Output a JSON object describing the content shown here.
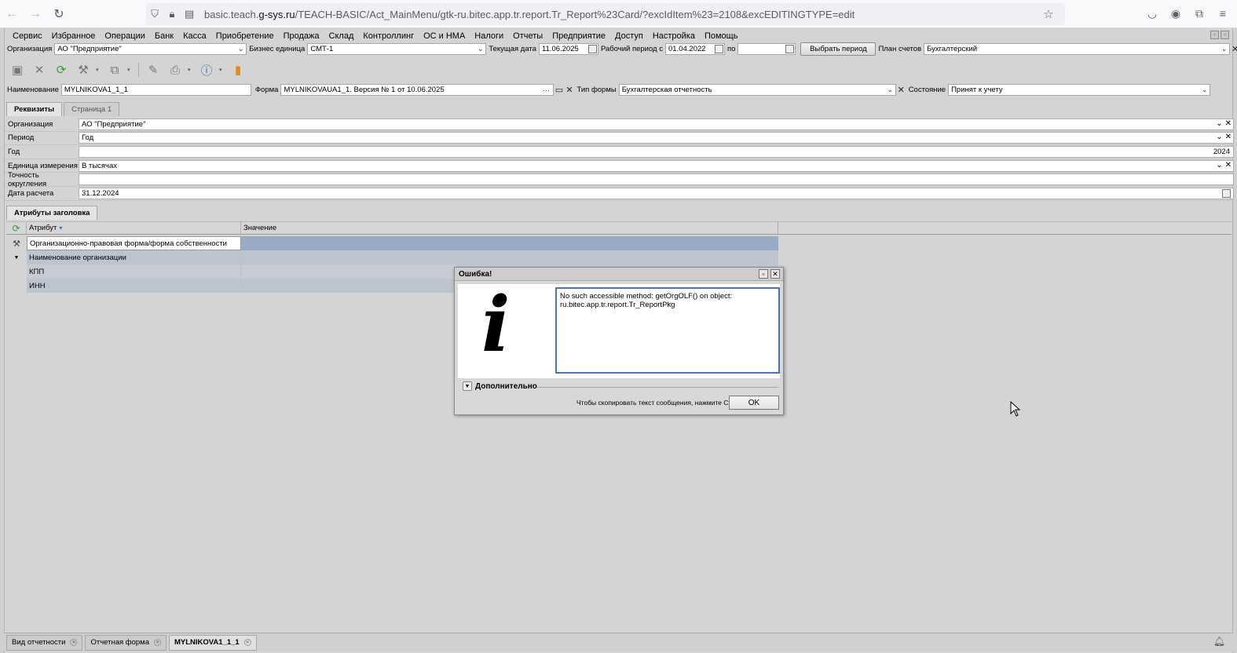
{
  "browser": {
    "url_prefix": "basic.teach.",
    "url_host": "g-sys.ru",
    "url_path": "/TEACH-BASIC/Act_MainMenu/gtk-ru.bitec.app.tr.report.Tr_Report%23Card/?excIdItem%23=2108&excEDITINGTYPE=edit"
  },
  "menu": [
    "Сервис",
    "Избранное",
    "Операции",
    "Банк",
    "Касса",
    "Приобретение",
    "Продажа",
    "Склад",
    "Контроллинг",
    "ОС и НМА",
    "Налоги",
    "Отчеты",
    "Предприятие",
    "Доступ",
    "Настройка",
    "Помощь"
  ],
  "filters": {
    "org_label": "Организация",
    "org_value": "АО \"Предприятие\"",
    "bu_label": "Бизнес единица",
    "bu_value": "СМТ-1",
    "date_label": "Текущая дата",
    "date_value": "11.06.2025",
    "period_label": "Рабочий период с",
    "period_from": "01.04.2022",
    "period_to_label": "по",
    "period_to": "",
    "choose_period": "Выбрать период",
    "chart_label": "План счетов",
    "chart_value": "Бухгалтерский"
  },
  "header": {
    "name_label": "Наименование",
    "name_value": "MYLNIKOVA1_1_1",
    "form_label": "Форма",
    "form_value": "MYLNIKOVAUA1_1. Версия № 1 от 10.06.2025",
    "form_dots": "···",
    "type_label": "Тип формы",
    "type_value": "Бухгалтерская отчетность",
    "state_label": "Состояние",
    "state_value": "Принят к учету"
  },
  "tabs": [
    "Реквизиты",
    "Страница 1"
  ],
  "props": [
    {
      "label": "Организация",
      "value": "АО \"Предприятие\""
    },
    {
      "label": "Период",
      "value": "Год"
    },
    {
      "label": "Год",
      "value": "2024"
    },
    {
      "label": "Единица измерения",
      "value": "В тысячах"
    },
    {
      "label": "Точность округления",
      "value": ""
    },
    {
      "label": "Дата расчета",
      "value": "31.12.2024"
    }
  ],
  "attr_tab": "Атрибуты заголовка",
  "attr_table": {
    "col_attr": "Атрибут",
    "col_value": "Значение",
    "rows": [
      {
        "attr": "Организационно-правовая форма/форма собственности",
        "value": ""
      },
      {
        "attr": "Наименование организации",
        "value": ""
      },
      {
        "attr": "КПП",
        "value": ""
      },
      {
        "attr": "ИНН",
        "value": ""
      }
    ]
  },
  "dialog": {
    "title": "Ошибка!",
    "info_glyph": "i",
    "message": "No such accessible method: getOrgOLF() on object:\nru.bitec.app.tr.report.Tr_ReportPkg",
    "more_label": "Дополнительно",
    "hint": "Чтобы скопировать текст сообщения, нажмите Ctrl+C",
    "ok": "OK"
  },
  "bottom_tabs": [
    "Вид отчетности",
    "Отчетная форма",
    "MYLNIKOVA1_1_1"
  ],
  "colors": {
    "selection": "#9aaac4",
    "dialog_border": "#4b73b5"
  }
}
